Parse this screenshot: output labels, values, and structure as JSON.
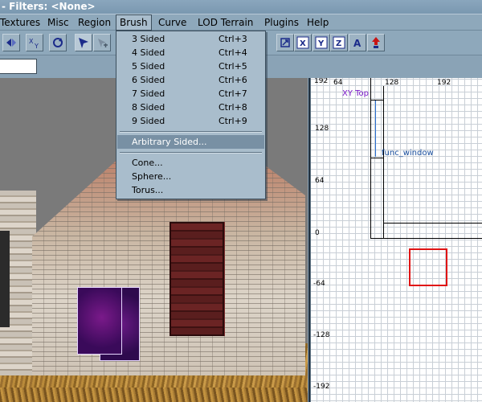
{
  "window": {
    "title": "- Filters: <None>"
  },
  "menubar": {
    "items": [
      {
        "label": "Textures"
      },
      {
        "label": "Misc"
      },
      {
        "label": "Region"
      },
      {
        "label": "Brush"
      },
      {
        "label": "Curve"
      },
      {
        "label": "LOD Terrain"
      },
      {
        "label": "Plugins"
      },
      {
        "label": "Help"
      }
    ],
    "active": "Brush"
  },
  "brush_menu": {
    "items": [
      {
        "label": "3 Sided",
        "shortcut": "Ctrl+3"
      },
      {
        "label": "4 Sided",
        "shortcut": "Ctrl+4"
      },
      {
        "label": "5 Sided",
        "shortcut": "Ctrl+5"
      },
      {
        "label": "6 Sided",
        "shortcut": "Ctrl+6"
      },
      {
        "label": "7 Sided",
        "shortcut": "Ctrl+7"
      },
      {
        "label": "8 Sided",
        "shortcut": "Ctrl+8"
      },
      {
        "label": "9 Sided",
        "shortcut": "Ctrl+9"
      },
      {
        "label": "Arbitrary Sided...",
        "shortcut": ""
      },
      {
        "label": "Cone...",
        "shortcut": ""
      },
      {
        "label": "Sphere...",
        "shortcut": ""
      },
      {
        "label": "Torus...",
        "shortcut": ""
      }
    ],
    "highlighted": "Arbitrary Sided..."
  },
  "toolbar": {
    "icons": [
      "flip-x-icon",
      "flip-xy-icon",
      "rotate-icon",
      "select-icon",
      "clipper-icon",
      "texture-lock-icon",
      "axis-x-icon",
      "axis-y-icon",
      "axis-z-icon",
      "axis-a-icon",
      "red-arrow-icon"
    ],
    "axis_labels": {
      "x": "X",
      "y": "Y",
      "z": "Z",
      "a": "A"
    }
  },
  "filter_input": {
    "value": ""
  },
  "grid_view": {
    "view_label": "XY Top",
    "entity_label": "func_window",
    "top_labels": [
      "192",
      "64",
      "128",
      "192"
    ],
    "side_labels": [
      "128",
      "64",
      "0",
      "-64",
      "-128",
      "-192"
    ]
  },
  "colors": {
    "chrome": "#8ea8bb",
    "menu_bg": "#a9bdcc",
    "highlight": "#7890a4",
    "selection_box": "#e01414",
    "view_label": "#7a18c8",
    "entity_label": "#1a4f9e"
  }
}
